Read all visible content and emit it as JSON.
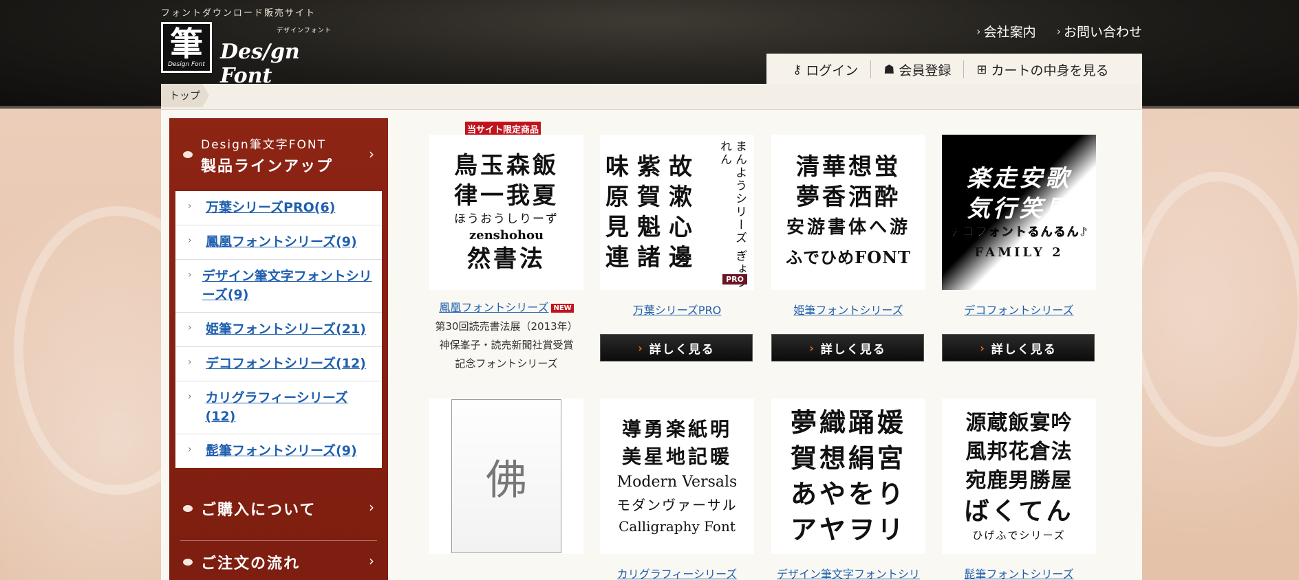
{
  "header": {
    "tagline": "フォントダウンロード販売サイト",
    "logo_kanji": "筆",
    "logo_sub": "Design Font",
    "logo_kana": "デザインフォント",
    "logo_name": "Des/gn Font",
    "links": [
      {
        "label": "会社案内"
      },
      {
        "label": "お問い合わせ"
      }
    ],
    "account": {
      "login": "ログイン",
      "register": "会員登録",
      "cart": "カートの中身を見る"
    }
  },
  "breadcrumb": {
    "home": "トップ"
  },
  "sidebar": {
    "head_line1": "Design筆文字FONT",
    "head_line2": "製品ラインアップ",
    "items": [
      {
        "label": "万葉シリーズPRO(6)"
      },
      {
        "label": "鳳凰フォントシリーズ(9)"
      },
      {
        "label": "デザイン筆文字フォントシリーズ(9)"
      },
      {
        "label": "姫筆フォントシリーズ(21)"
      },
      {
        "label": "デコフォントシリーズ(12)"
      },
      {
        "label": "カリグラフィーシリーズ(12)"
      },
      {
        "label": "髭筆フォントシリーズ(9)"
      }
    ],
    "sections": [
      {
        "label": "ご購入について"
      },
      {
        "label": "ご注文の流れ"
      }
    ]
  },
  "products": [
    {
      "badge_top": "当サイト限定商品",
      "img_rows": [
        "鳥玉森飯",
        "律一我夏"
      ],
      "img_kana": "ほうおうしりーず",
      "img_latin": "zenshohou",
      "img_bottom": "然書法",
      "link": "鳳凰フォントシリーズ",
      "new_badge": "NEW",
      "desc": [
        "第30回読売書法展（2013年）",
        "神保峯子・読売新聞社賞受賞",
        "記念フォントシリーズ"
      ]
    },
    {
      "img_rows": [
        "味紫故",
        "原賀漱",
        "見魁心",
        "連諸邊"
      ],
      "img_vert": "まんようシリーズ ぎょうれん",
      "pro_tag": "PRO",
      "link": "万葉シリーズPRO",
      "button": "詳しく見る"
    },
    {
      "img_rows": [
        "清華想蛍",
        "夢香洒酔"
      ],
      "img_kana": "安游書体へ游",
      "img_latin": "ふでひめFONT",
      "link": "姫筆フォントシリーズ",
      "button": "詳しく見る"
    },
    {
      "img_rows": [
        "楽走安歌",
        "気行笑風"
      ],
      "img_kana": "デコフォントるんるん♪",
      "img_latin": "FAMILY 2",
      "link": "デコフォントシリーズ",
      "button": "詳しく見る"
    }
  ],
  "products_row2": [
    {
      "img_icon": "佛"
    },
    {
      "img_rows": [
        "導勇楽紙明",
        "美星地記暖"
      ],
      "img_latin1": "Modern Versals",
      "img_kana": "モダンヴァーサル",
      "img_latin2": "Calligraphy Font",
      "link": "カリグラフィーシリーズ"
    },
    {
      "img_rows": [
        "夢織踊媛",
        "賀想絹宮",
        "あやをり",
        "アヤヲリ"
      ],
      "link": "デザイン筆文字フォントシリーズ"
    },
    {
      "img_rows": [
        "源蔵飯宴吟",
        "風邦花倉法",
        "宛鹿男勝屋",
        "ばくてん"
      ],
      "img_kana": "ひげふでシリーズ",
      "link": "髭筆フォントシリーズ"
    }
  ]
}
